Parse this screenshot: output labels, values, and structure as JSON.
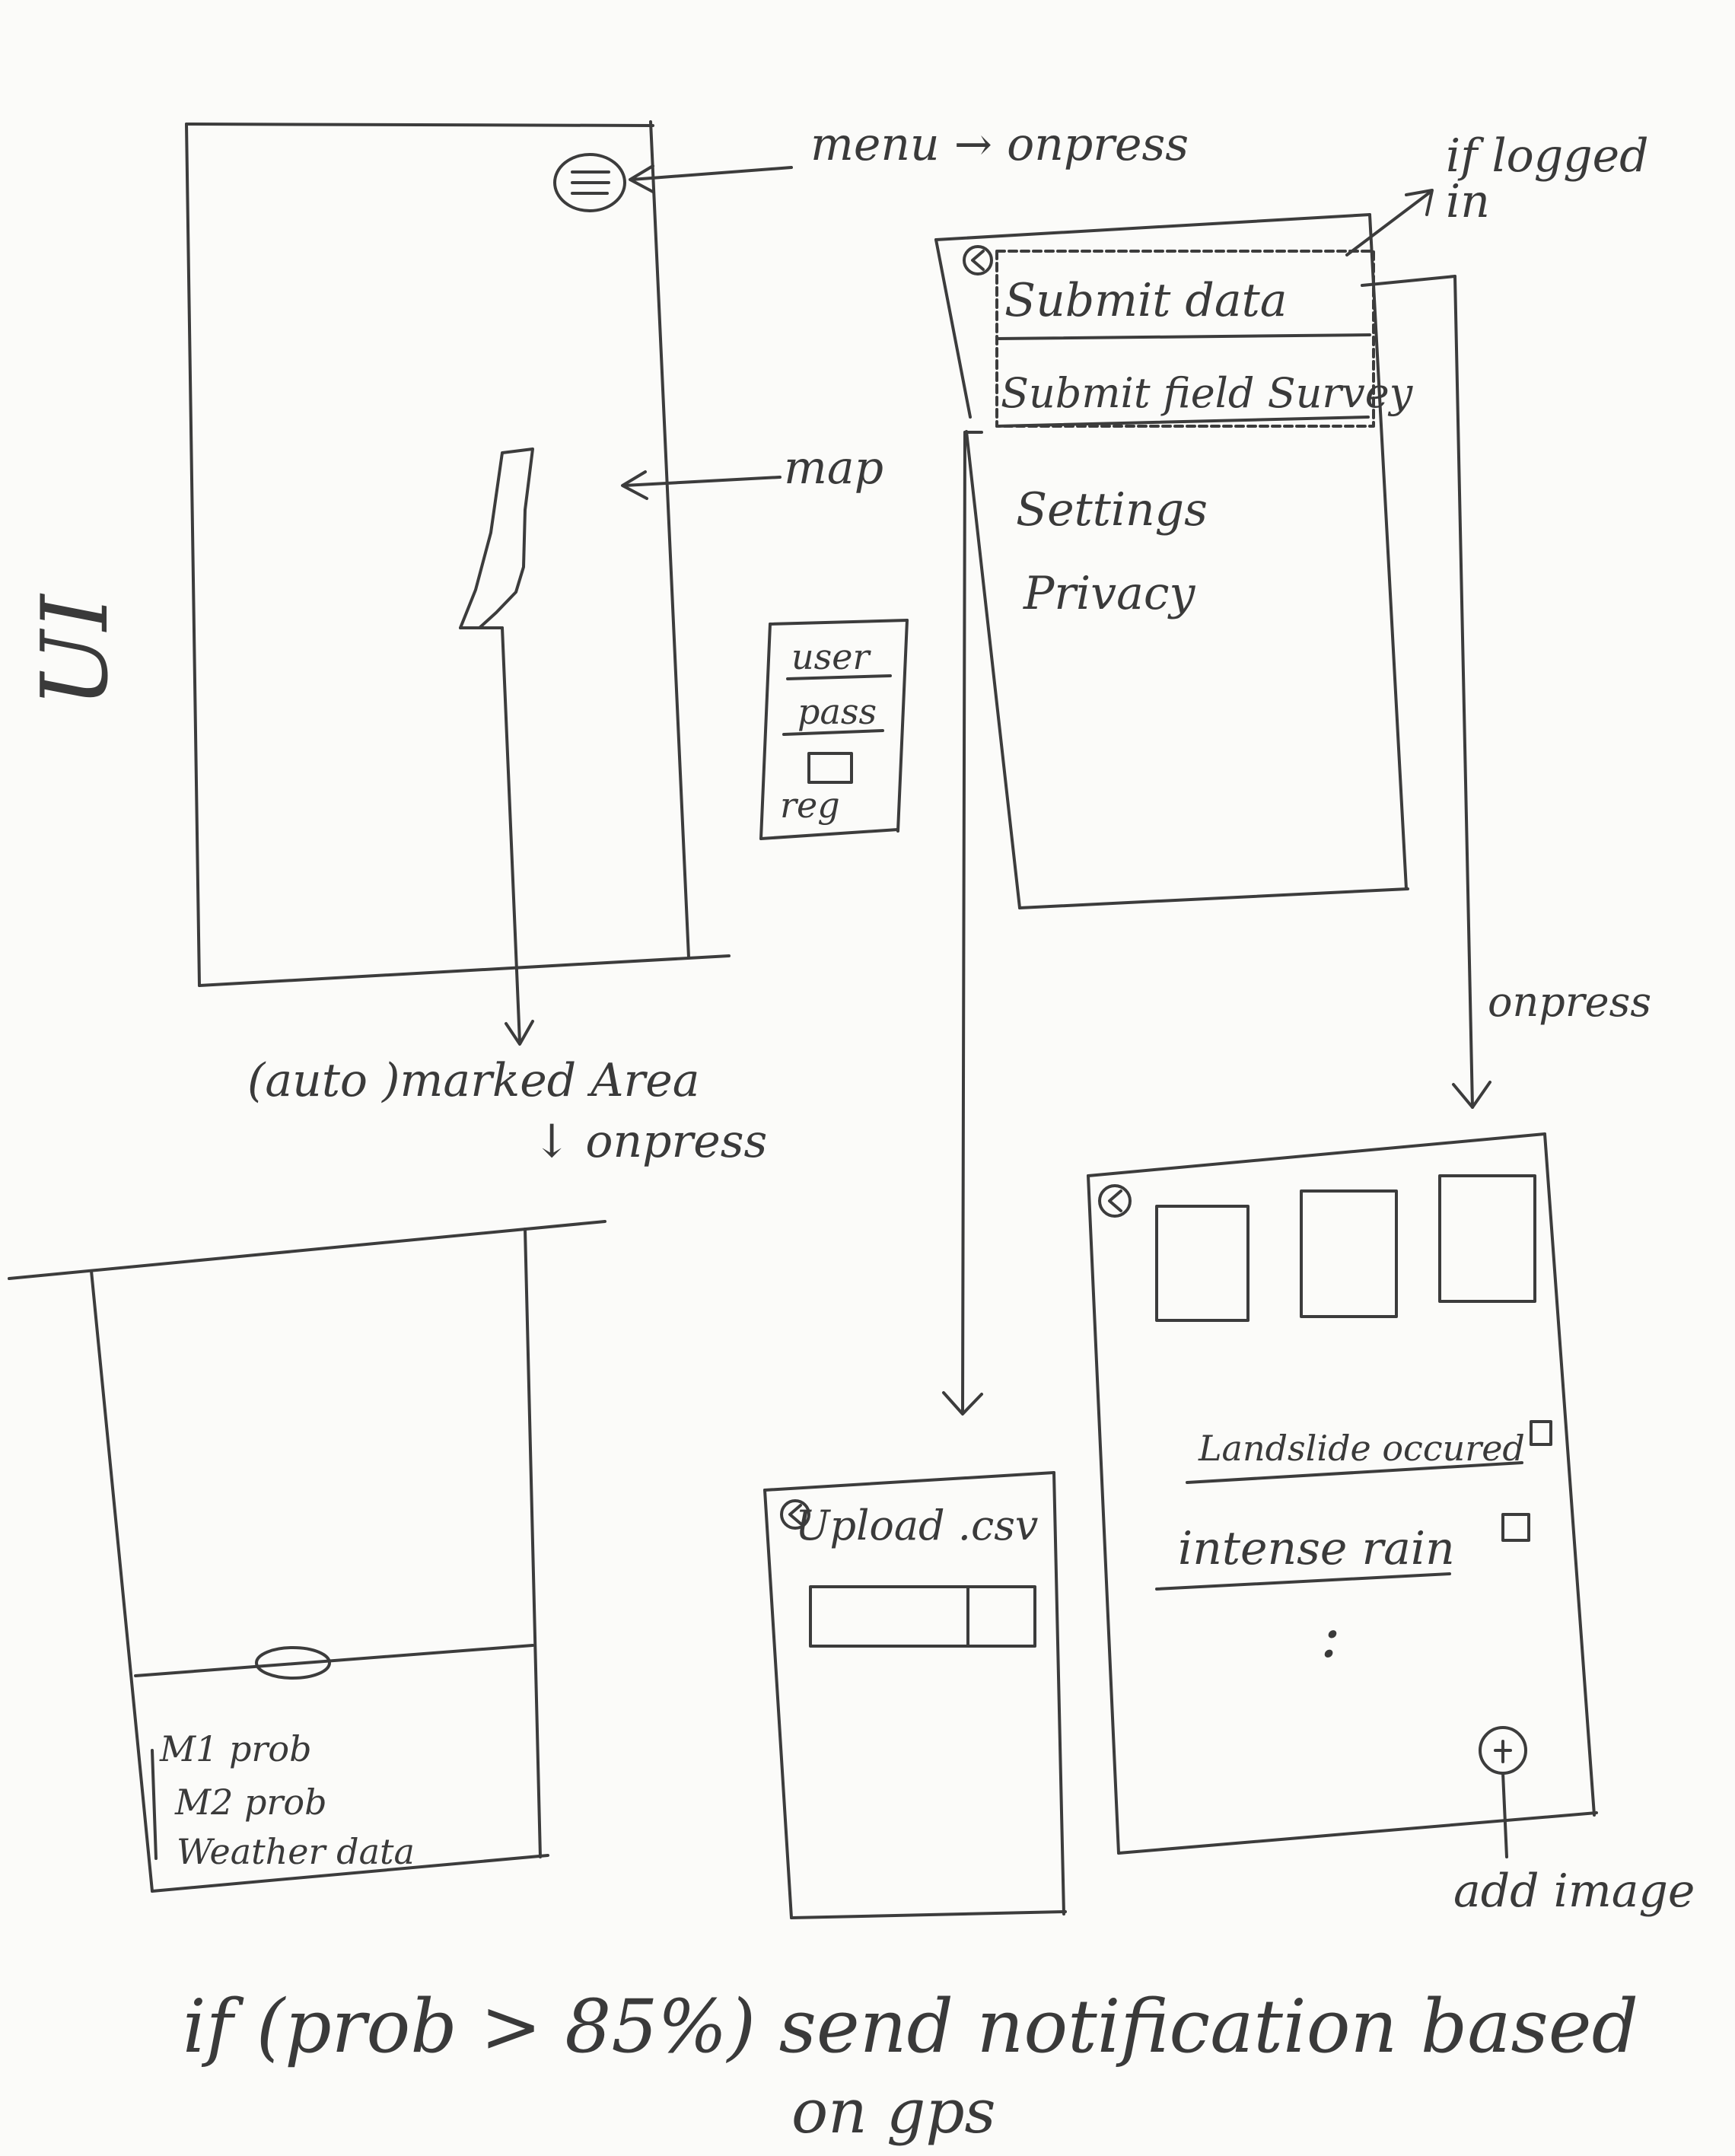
{
  "side_title": "UI",
  "screen_main": {
    "menu_note": "menu → onpress",
    "map_note": "map",
    "marked_area_note": "(auto )marked Area",
    "onpress_note": "↓ onpress"
  },
  "login_box": {
    "user": "user",
    "pass": "pass",
    "reg": "reg"
  },
  "menu_screen": {
    "items": [
      "Submit data",
      "Submit field Survey",
      "Settings",
      "Privacy"
    ],
    "if_logged_in_note": "if logged in",
    "onpress_note": "onpress"
  },
  "detail_screen": {
    "rows": [
      "M1 prob",
      "M2 prob",
      "Weather data"
    ]
  },
  "upload_screen": {
    "title": "Upload .csv"
  },
  "survey_screen": {
    "checks": [
      "Landslide occured",
      "intense rain"
    ],
    "ellipsis": ":",
    "add_image_note": "add image"
  },
  "footer_note": {
    "line1": "if (prob > 85%) send notification based",
    "line2": "on gps"
  }
}
